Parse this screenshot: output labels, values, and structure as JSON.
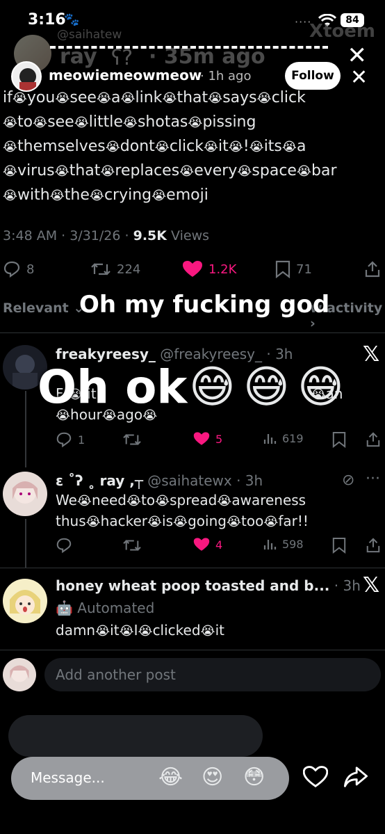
{
  "status_bar": {
    "time": "3:16",
    "battery": "84"
  },
  "story": {
    "ghost": {
      "handle": "@saihatew",
      "name": "ray",
      "time": "· 35m ago",
      "right": "Xtoem"
    },
    "username": "meowiemeowmeow",
    "time": "· 1h ago",
    "follow_label": "Follow"
  },
  "tweet": {
    "lines": [
      [
        "if",
        "you",
        "see",
        "a",
        "link",
        "that",
        "says",
        "click"
      ],
      [
        "to",
        "see",
        "little",
        "shotas",
        "pissing"
      ],
      [
        "themselves",
        "dont",
        "click",
        "it",
        "!",
        "its",
        "a"
      ],
      [
        "virus",
        "that",
        "replaces",
        "every",
        "space",
        "bar"
      ],
      [
        "with",
        "the",
        "crying",
        "emoji"
      ]
    ],
    "meta_time": "3:48 AM · 3/31/26 · ",
    "views_count": "9.5K",
    "views_label": " Views",
    "stats": {
      "replies": "8",
      "reposts": "224",
      "likes": "1.2K",
      "bookmarks": "71"
    }
  },
  "filter": {
    "relevant": "Relevant",
    "activity": "w activity"
  },
  "overlays": {
    "top": "Oh my fucking god",
    "middle": "Oh ok"
  },
  "replies": [
    {
      "name": "freakyreesy_",
      "meta": " @freakyreesy_ · 3h",
      "line1_left": "F",
      "line1_mid": "it",
      "line1_right": "an",
      "line2": [
        "hour",
        "ago"
      ],
      "stats": {
        "replies": "1",
        "likes": "5",
        "views": "619"
      }
    },
    {
      "name": "ɛ ˚ʔ ˳ ray ,┬",
      "meta": " @saihatewx · 3h",
      "lines": [
        [
          "We",
          "need",
          "to",
          "spread",
          "awareness"
        ],
        [
          "thus",
          "hacker",
          "is",
          "going",
          "too",
          "far!!"
        ]
      ],
      "stats": {
        "likes": "4",
        "views": "598"
      }
    },
    {
      "name": "honey wheat poop toasted and b...",
      "meta": " · 3h",
      "automated": "Automated",
      "lines": [
        [
          "damn",
          "it",
          "I",
          "clicked",
          "it"
        ]
      ]
    }
  ],
  "composer": {
    "placeholder": "Add another post"
  },
  "message_bar": {
    "placeholder": "Message...",
    "quick_reactions": [
      "😂",
      "😍",
      "😳"
    ]
  },
  "icons": [
    "paw-icon",
    "wifi-icon",
    "close-icon",
    "reply-icon",
    "repost-icon",
    "heart-icon",
    "bookmark-icon",
    "share-icon",
    "views-icon",
    "x-logo-icon",
    "crying-emoji-icon",
    "sweat-smile-emoji-icon"
  ],
  "colors": {
    "like_pink": "#f91880",
    "muted": "#71767b",
    "text": "#e7e9ea"
  }
}
